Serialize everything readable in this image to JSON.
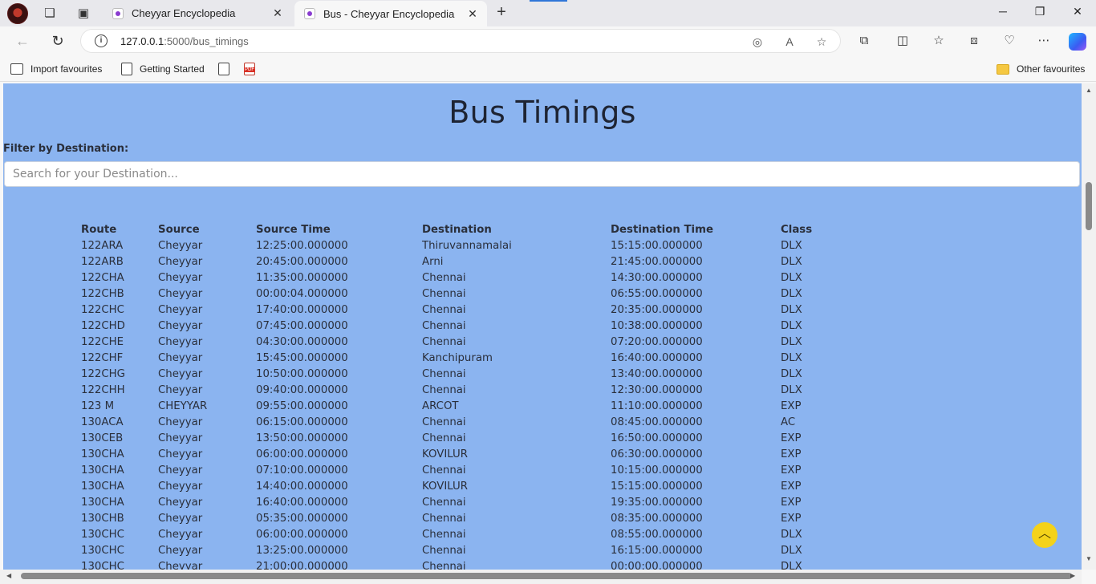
{
  "browser": {
    "tabs": [
      {
        "title": "Cheyyar Encyclopedia",
        "active": false
      },
      {
        "title": "Bus - Cheyyar Encyclopedia",
        "active": true
      }
    ],
    "url_host": "127.0.0.1",
    "url_rest": ":5000/bus_timings",
    "favourites": [
      {
        "label": "Import favourites",
        "icon": "import-icon"
      },
      {
        "label": "Getting Started",
        "icon": "page-icon"
      },
      {
        "label": "",
        "icon": "page-icon"
      },
      {
        "label": "",
        "icon": "pdf-icon"
      }
    ],
    "other_favourites": "Other favourites"
  },
  "page": {
    "title": "Bus Timings",
    "filter_label": "Filter by Destination:",
    "search_placeholder": "Search for your Destination..."
  },
  "table": {
    "headers": [
      "Route",
      "Source",
      "Source Time",
      "Destination",
      "Destination Time",
      "Class"
    ],
    "rows": [
      [
        "122ARA",
        "Cheyyar",
        "12:25:00.000000",
        "Thiruvannamalai",
        "15:15:00.000000",
        "DLX"
      ],
      [
        "122ARB",
        "Cheyyar",
        "20:45:00.000000",
        "Arni",
        "21:45:00.000000",
        "DLX"
      ],
      [
        "122CHA",
        "Cheyyar",
        "11:35:00.000000",
        "Chennai",
        "14:30:00.000000",
        "DLX"
      ],
      [
        "122CHB",
        "Cheyyar",
        "00:00:04.000000",
        "Chennai",
        "06:55:00.000000",
        "DLX"
      ],
      [
        "122CHC",
        "Cheyyar",
        "17:40:00.000000",
        "Chennai",
        "20:35:00.000000",
        "DLX"
      ],
      [
        "122CHD",
        "Cheyyar",
        "07:45:00.000000",
        "Chennai",
        "10:38:00.000000",
        "DLX"
      ],
      [
        "122CHE",
        "Cheyyar",
        "04:30:00.000000",
        "Chennai",
        "07:20:00.000000",
        "DLX"
      ],
      [
        "122CHF",
        "Cheyyar",
        "15:45:00.000000",
        "Kanchipuram",
        "16:40:00.000000",
        "DLX"
      ],
      [
        "122CHG",
        "Cheyyar",
        "10:50:00.000000",
        "Chennai",
        "13:40:00.000000",
        "DLX"
      ],
      [
        "122CHH",
        "Cheyyar",
        "09:40:00.000000",
        "Chennai",
        "12:30:00.000000",
        "DLX"
      ],
      [
        "123 M",
        "CHEYYAR",
        "09:55:00.000000",
        "ARCOT",
        "11:10:00.000000",
        "EXP"
      ],
      [
        "130ACA",
        "Cheyyar",
        "06:15:00.000000",
        "Chennai",
        "08:45:00.000000",
        "AC"
      ],
      [
        "130CEB",
        "Cheyyar",
        "13:50:00.000000",
        "Chennai",
        "16:50:00.000000",
        "EXP"
      ],
      [
        "130CHA",
        "Cheyyar",
        "06:00:00.000000",
        "KOVILUR",
        "06:30:00.000000",
        "EXP"
      ],
      [
        "130CHA",
        "Cheyyar",
        "07:10:00.000000",
        "Chennai",
        "10:15:00.000000",
        "EXP"
      ],
      [
        "130CHA",
        "Cheyyar",
        "14:40:00.000000",
        "KOVILUR",
        "15:15:00.000000",
        "EXP"
      ],
      [
        "130CHA",
        "Cheyyar",
        "16:40:00.000000",
        "Chennai",
        "19:35:00.000000",
        "EXP"
      ],
      [
        "130CHB",
        "Cheyyar",
        "05:35:00.000000",
        "Chennai",
        "08:35:00.000000",
        "EXP"
      ],
      [
        "130CHC",
        "Cheyyar",
        "06:00:00.000000",
        "Chennai",
        "08:55:00.000000",
        "DLX"
      ],
      [
        "130CHC",
        "Cheyyar",
        "13:25:00.000000",
        "Chennai",
        "16:15:00.000000",
        "DLX"
      ],
      [
        "130CHC",
        "Cheyyar",
        "21:00:00.000000",
        "Chennai",
        "00:00:00.000000",
        "DLX"
      ]
    ]
  },
  "colors": {
    "page_background": "#8bb4f0",
    "back_to_top": "#f4d21a"
  }
}
